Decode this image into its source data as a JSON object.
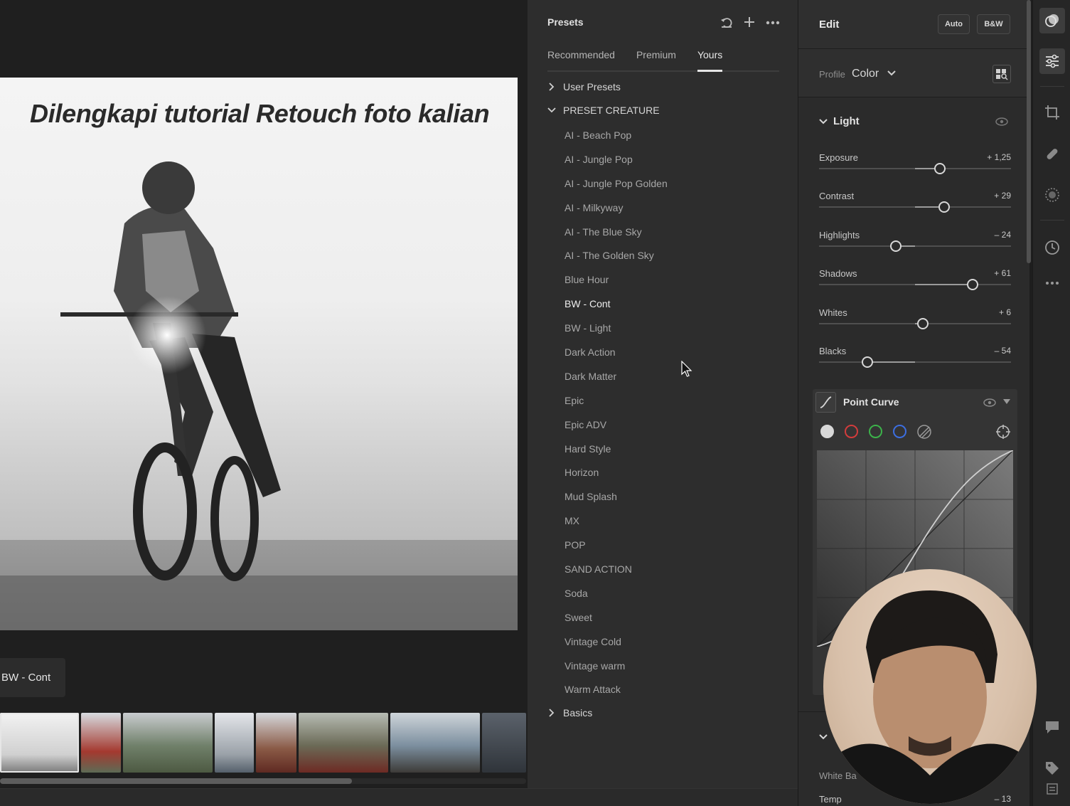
{
  "photo": {
    "overlay_title": "Dilengkapi tutorial Retouch foto kalian",
    "applied_preset_tag": "BW - Cont"
  },
  "presets": {
    "title": "Presets",
    "tabs": [
      {
        "label": "Recommended",
        "active": false
      },
      {
        "label": "Premium",
        "active": false
      },
      {
        "label": "Yours",
        "active": true
      }
    ],
    "groups": {
      "user_presets": "User Presets",
      "preset_creature": "PRESET CREATURE",
      "basics": "Basics"
    },
    "items": [
      "AI - Beach Pop",
      "AI - Jungle Pop",
      "AI - Jungle Pop Golden",
      "AI - Milkyway",
      "AI - The Blue Sky",
      "AI - The Golden Sky",
      "Blue Hour",
      "BW - Cont",
      "BW - Light",
      "Dark Action",
      "Dark Matter",
      "Epic",
      "Epic ADV",
      "Hard Style",
      "Horizon",
      "Mud Splash",
      "MX",
      "POP",
      "SAND ACTION",
      "Soda",
      "Sweet",
      "Vintage Cold",
      "Vintage warm",
      "Warm Attack"
    ],
    "current_item": "BW - Cont"
  },
  "edit": {
    "title": "Edit",
    "auto_label": "Auto",
    "bw_label": "B&W",
    "profile_label": "Profile",
    "profile_value": "Color",
    "light_label": "Light",
    "sliders": [
      {
        "label": "Exposure",
        "value": "+ 1,25",
        "pos": 0.63
      },
      {
        "label": "Contrast",
        "value": "+ 29",
        "pos": 0.65
      },
      {
        "label": "Highlights",
        "value": "– 24",
        "pos": 0.4
      },
      {
        "label": "Shadows",
        "value": "+ 61",
        "pos": 0.8
      },
      {
        "label": "Whites",
        "value": "+ 6",
        "pos": 0.54
      },
      {
        "label": "Blacks",
        "value": "– 54",
        "pos": 0.25
      }
    ],
    "point_curve_label": "Point Curve",
    "white_balance_label": "White Ba",
    "temp_label": "Temp",
    "temp_value": "– 13"
  },
  "colors": {
    "accent": "#e6e6e6",
    "red_channel": "#d23c3c",
    "green_channel": "#3cb24a",
    "blue_channel": "#3c6ee0"
  }
}
